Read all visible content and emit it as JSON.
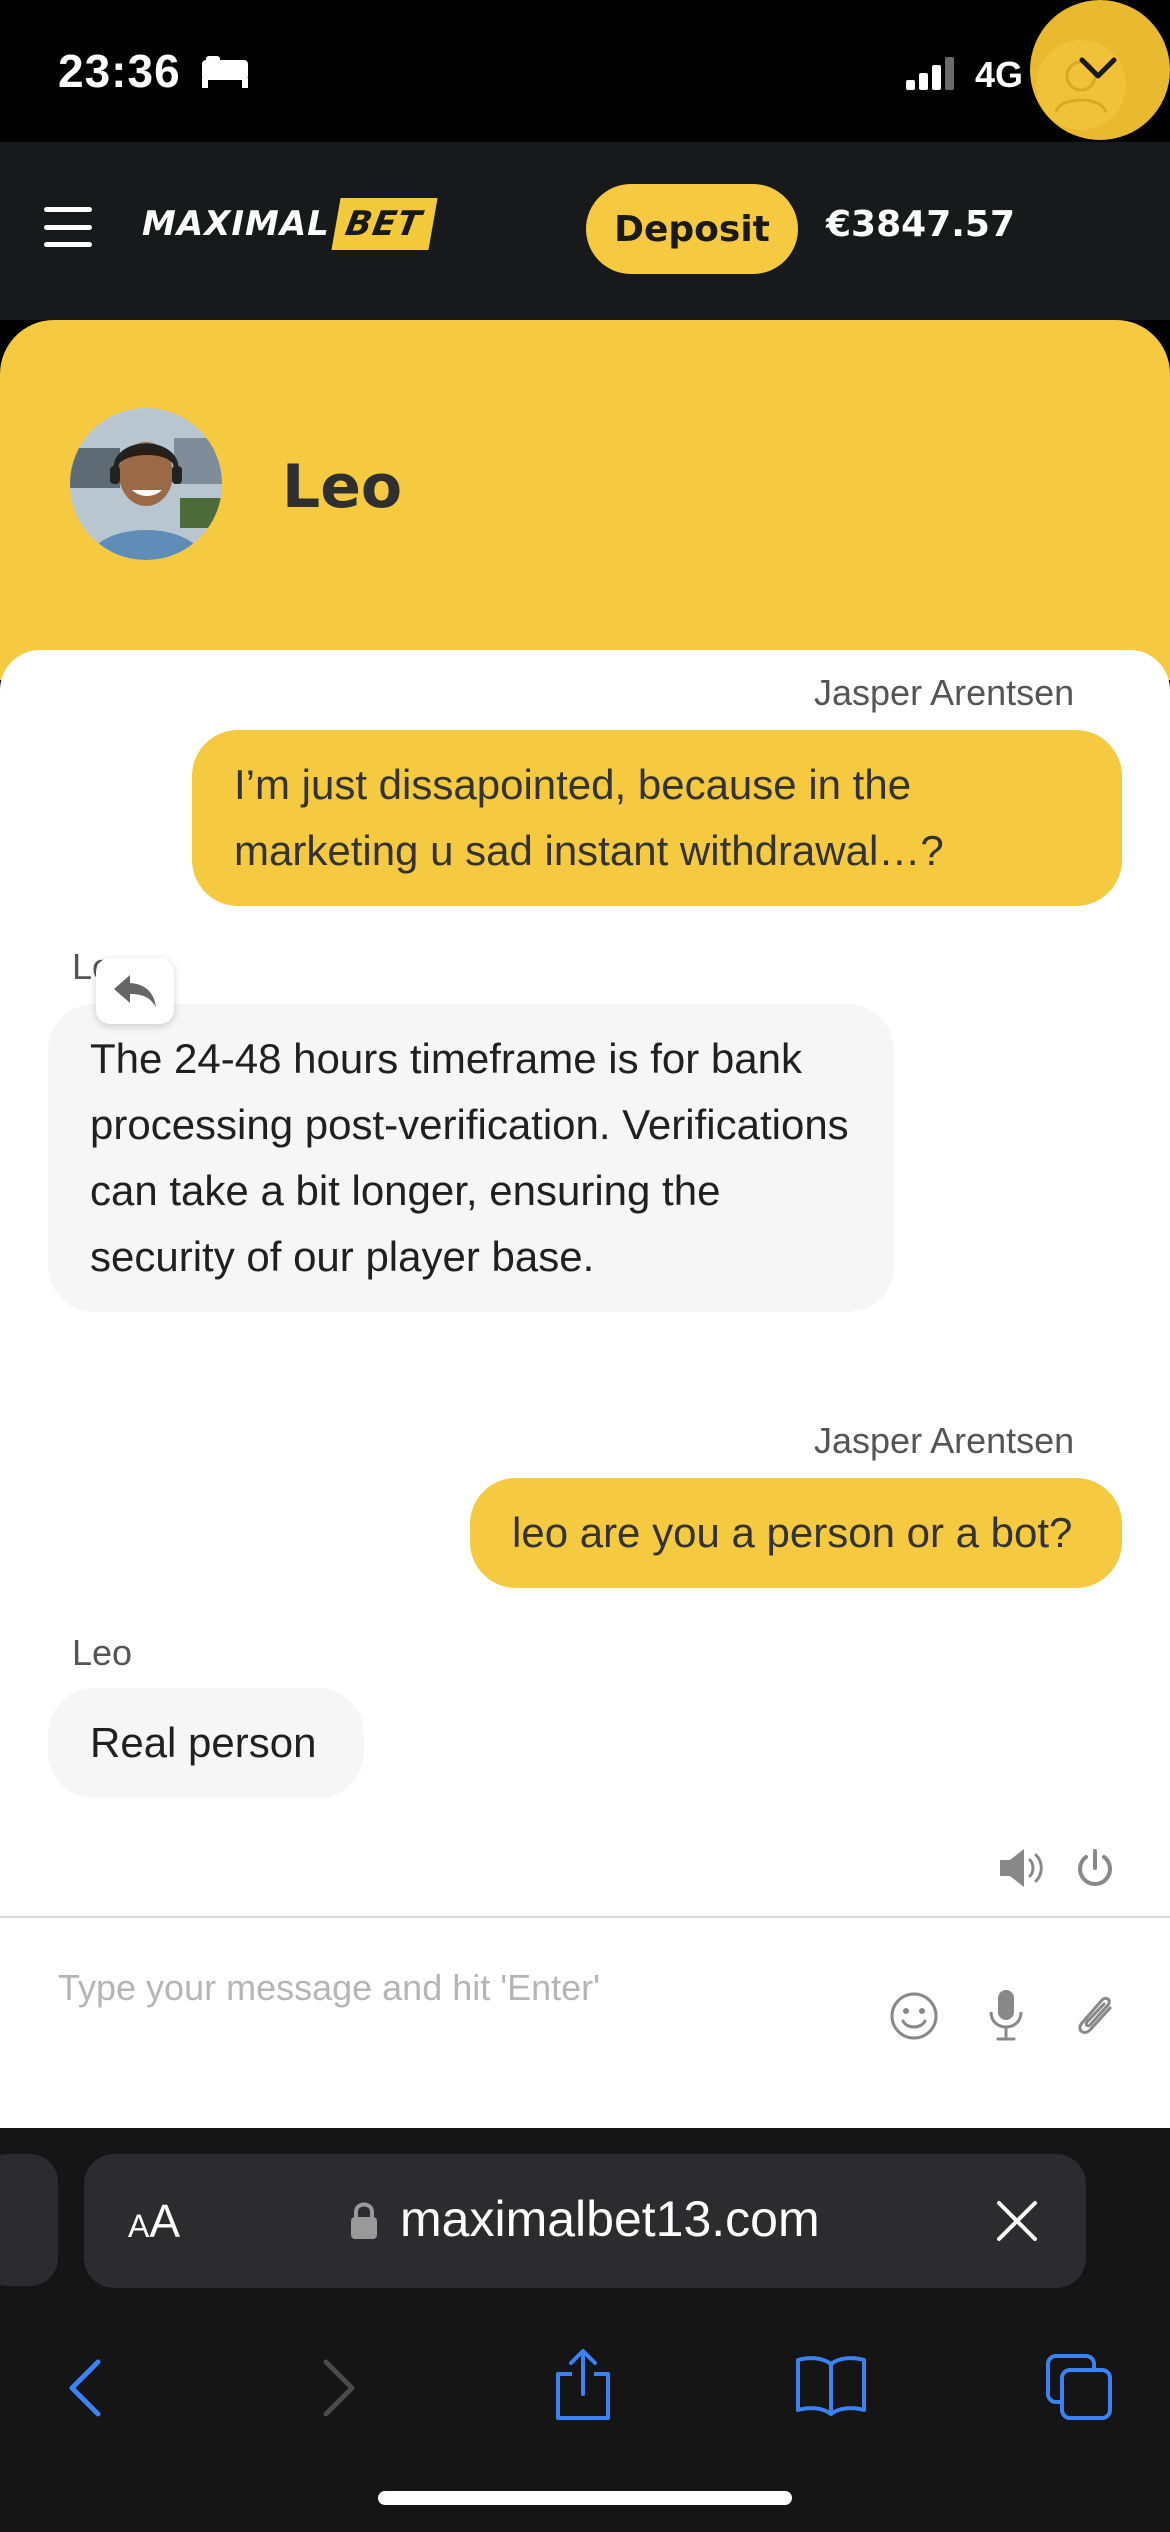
{
  "status_bar": {
    "time": "23:36",
    "network": "4G"
  },
  "header": {
    "logo_main": "MAXIMAL",
    "logo_accent": "BET",
    "deposit_label": "Deposit",
    "balance": "€3847.57"
  },
  "chat": {
    "agent_name": "Leo",
    "messages": [
      {
        "sender": "Jasper Arentsen",
        "text": "I’m just dissapointed, because in the marketing u sad instant withdrawal…?",
        "direction": "outgoing"
      },
      {
        "sender": "Leo",
        "text": "The 24-48 hours timeframe is for bank processing post-verification. Verifications can take a bit longer, ensuring the security of our player base.",
        "direction": "incoming"
      },
      {
        "sender": "Jasper Arentsen",
        "text": "leo are you a person or a bot?",
        "direction": "outgoing"
      },
      {
        "sender": "Leo",
        "text": "Real person",
        "direction": "incoming"
      }
    ],
    "input_placeholder": "Type your message and hit 'Enter'"
  },
  "browser": {
    "aa_label_small": "A",
    "aa_label_large": "A",
    "url": "maximalbet13.com"
  },
  "colors": {
    "brand_yellow": "#f5ca41",
    "header_dark": "#18191b",
    "browser_link_blue": "#3b82f6"
  }
}
